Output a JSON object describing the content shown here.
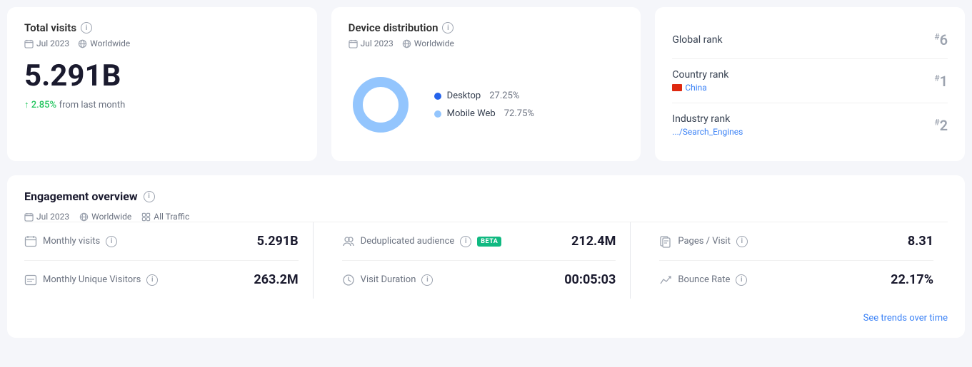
{
  "totalVisits": {
    "title": "Total visits",
    "date": "Jul 2023",
    "region": "Worldwide",
    "value": "5.291B",
    "change": "↑ 2.85%",
    "changeText": "from last month"
  },
  "deviceDistribution": {
    "title": "Device distribution",
    "date": "Jul 2023",
    "region": "Worldwide",
    "desktop": {
      "label": "Desktop",
      "percent": "27.25%",
      "value": 27.25
    },
    "mobile": {
      "label": "Mobile Web",
      "percent": "72.75%",
      "value": 72.75
    }
  },
  "ranks": {
    "global": {
      "label": "Global rank",
      "value": "#6"
    },
    "country": {
      "label": "Country rank",
      "sublabel": "China",
      "value": "#1"
    },
    "industry": {
      "label": "Industry rank",
      "sublabel": ".../Search_Engines",
      "value": "#2"
    }
  },
  "engagement": {
    "title": "Engagement overview",
    "date": "Jul 2023",
    "region": "Worldwide",
    "traffic": "All Traffic",
    "metrics": [
      {
        "icon": "📅",
        "label": "Monthly visits",
        "value": "5.291B"
      },
      {
        "icon": "👥",
        "label": "Deduplicated audience",
        "value": "212.4M",
        "beta": true
      },
      {
        "icon": "📋",
        "label": "Pages / Visit",
        "value": "8.31"
      },
      {
        "icon": "🪪",
        "label": "Monthly Unique Visitors",
        "value": "263.2M"
      },
      {
        "icon": "⏱",
        "label": "Visit Duration",
        "value": "00:05:03"
      },
      {
        "icon": "📉",
        "label": "Bounce Rate",
        "value": "22.17%"
      }
    ],
    "seeMoreLabel": "See trends over time"
  },
  "icons": {
    "info": "i",
    "calendar": "📅",
    "globe": "🌐",
    "people": "👥",
    "pages": "🗒",
    "visitor": "🪪",
    "timer": "⏱",
    "bounce": "📉",
    "traffic": "⊞"
  }
}
